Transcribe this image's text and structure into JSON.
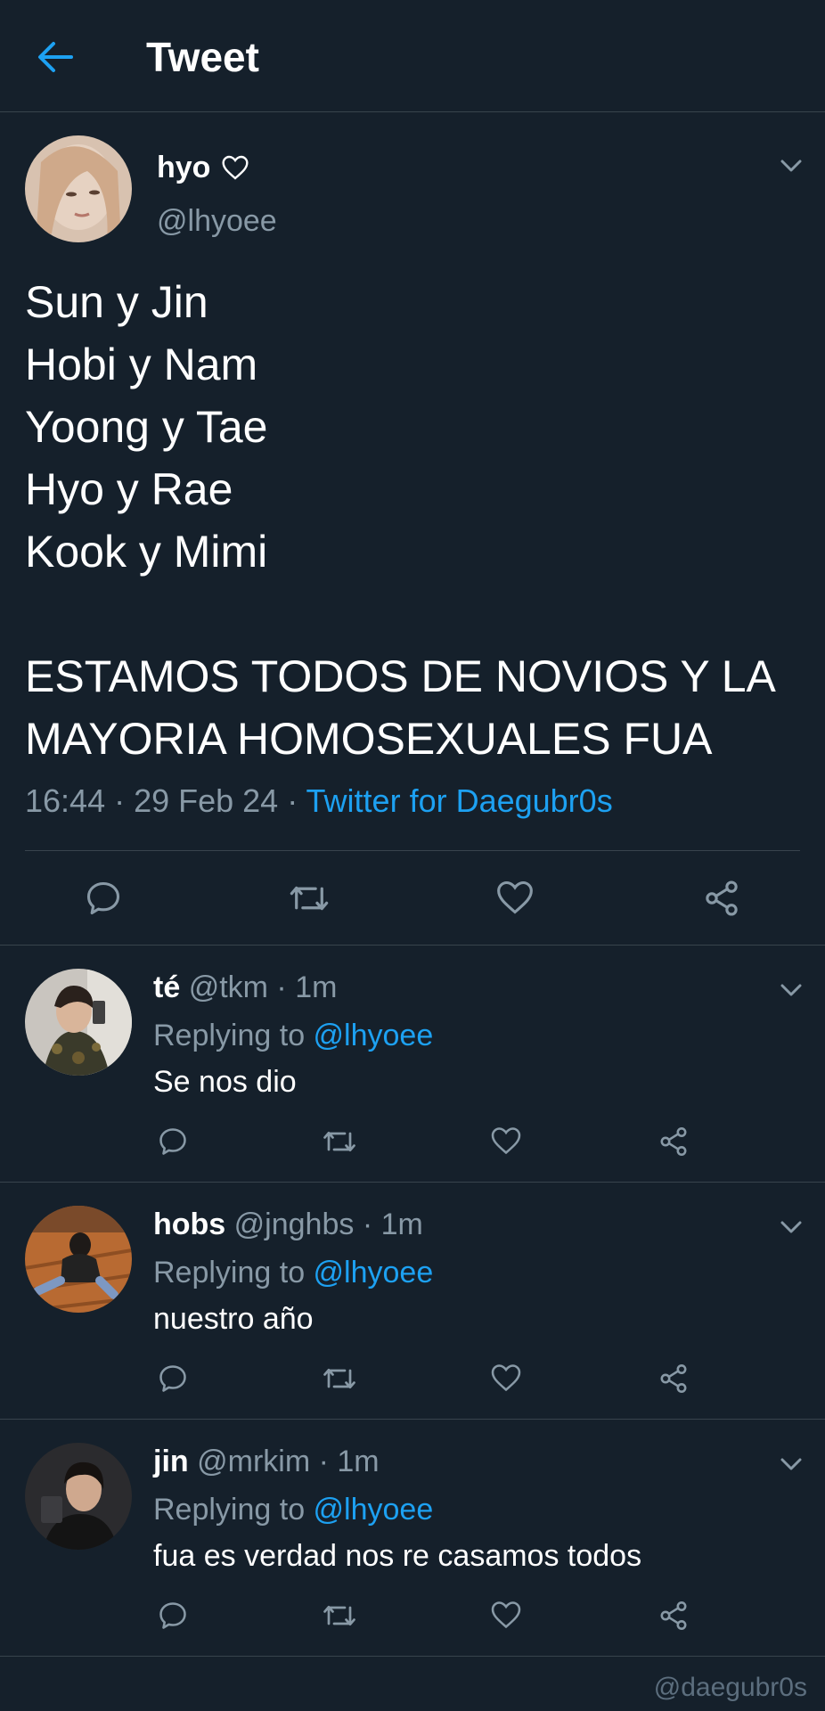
{
  "header": {
    "title": "Tweet",
    "back_icon": "arrow-left-icon"
  },
  "colors": {
    "background": "#15202b",
    "accent": "#1da1f2",
    "muted": "#8899a6",
    "divider": "#38444d"
  },
  "main_tweet": {
    "name": "hyo",
    "name_icon": "heart-outline-icon",
    "handle": "@lhyoee",
    "text": "Sun y Jin\nHobi y Nam\nYoong y Tae\nHyo y Rae\nKook y Mimi\n\nESTAMOS TODOS DE NOVIOS Y LA\nMAYORIA HOMOSEXUALES FUA",
    "time": "16:44 · 29 Feb 24 · ",
    "source": "Twitter for Daegubr0s"
  },
  "replies": [
    {
      "name": "té",
      "handle": "@tkm",
      "dot": " · ",
      "time": "1m",
      "replying_label": "Replying to ",
      "mention": "@lhyoee",
      "text": "Se nos dio"
    },
    {
      "name": "hobs",
      "handle": "@jnghbs",
      "dot": " · ",
      "time": "1m",
      "replying_label": "Replying to ",
      "mention": "@lhyoee",
      "text": "nuestro año"
    },
    {
      "name": "jin",
      "handle": "@mrkim",
      "dot": " · ",
      "time": "1m",
      "replying_label": "Replying to ",
      "mention": "@lhyoee",
      "text": "fua es verdad nos re casamos todos"
    }
  ],
  "watermark": "@daegubr0s"
}
